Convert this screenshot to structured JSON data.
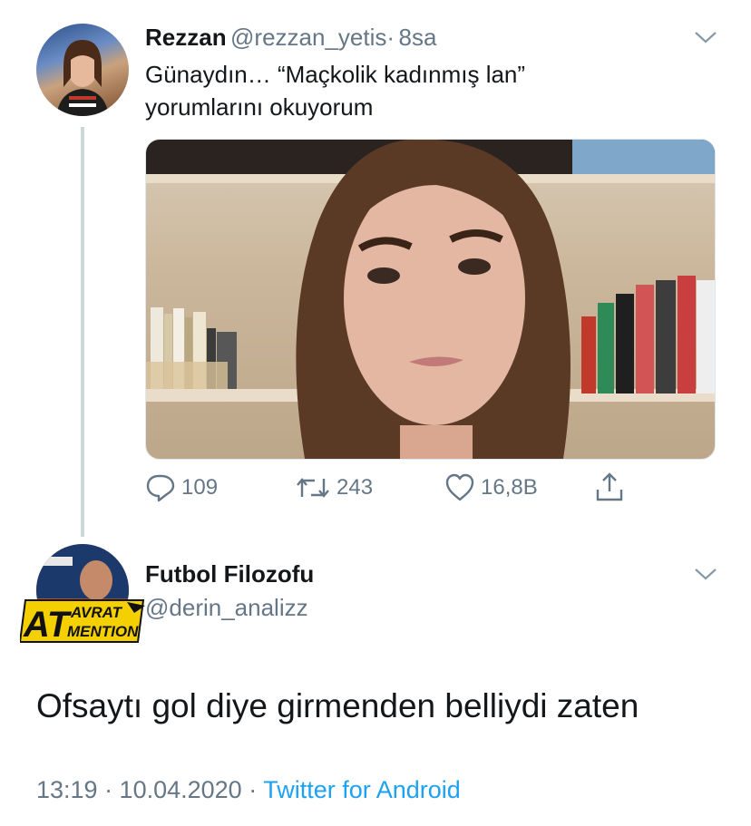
{
  "quoted_tweet": {
    "display_name": "Rezzan",
    "handle": "@rezzan_yetis",
    "separator": "·",
    "time_ago": "8sa",
    "text_line1": "Günaydın… “Maçkolik kadınmış lan”",
    "text_line2": "yorumlarını okuyorum",
    "actions": {
      "reply_count": "109",
      "retweet_count": "243",
      "like_count": "16,8B"
    }
  },
  "reply_tweet": {
    "display_name": "Futbol Filozofu",
    "handle": "@derin_analizz",
    "avatar_text": {
      "line1": "AVRAT",
      "line2": "MENTION",
      "prefix": "AT"
    },
    "text": "Ofsaytı gol diye girmenden belliydi zaten",
    "timestamp": "13:19 · 10.04.2020 ·",
    "source": "Twitter for Android"
  },
  "colors": {
    "link": "#1da1f2",
    "muted": "#657786",
    "thread_line": "#ccd6dd"
  },
  "icons": [
    "reply-icon",
    "retweet-icon",
    "like-icon",
    "share-icon",
    "chevron-down-icon"
  ]
}
